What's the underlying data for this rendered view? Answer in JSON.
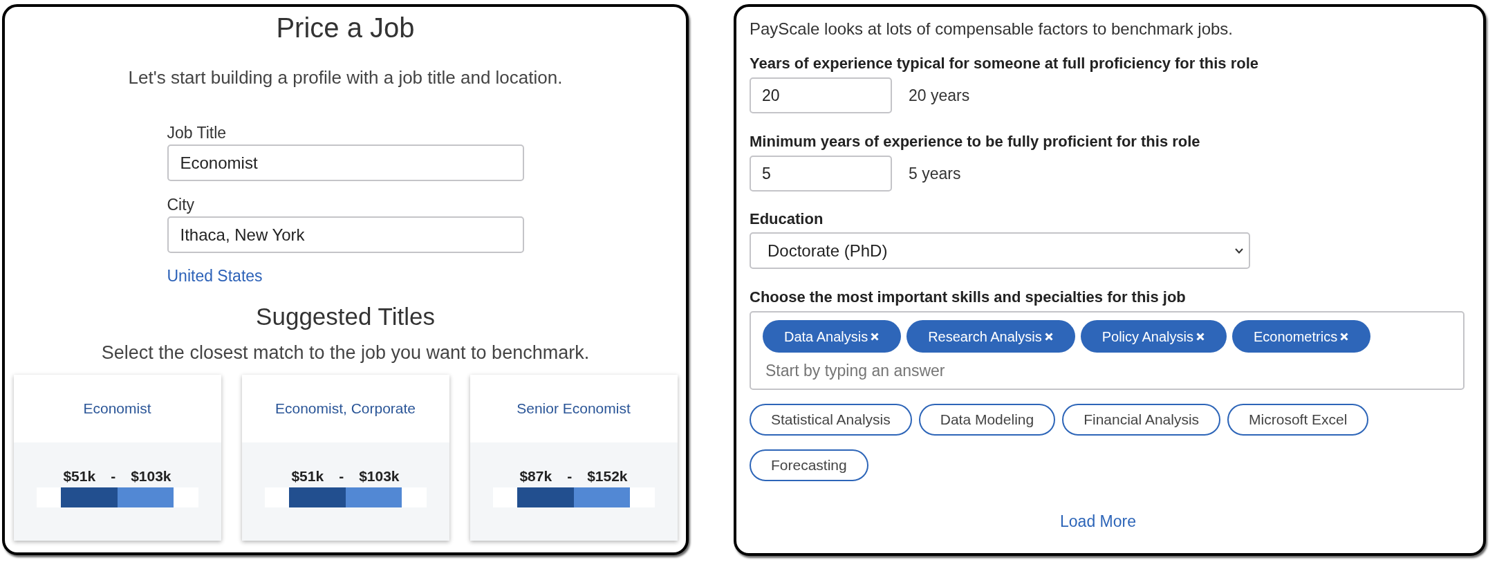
{
  "price_job_panel": {
    "title": "Price a Job",
    "subtitle": "Let's start building a profile with a job title and location.",
    "fields": [
      {
        "label": "Job Title",
        "value": "Economist"
      },
      {
        "label": "City",
        "value": "Ithaca, New York"
      }
    ],
    "country_link": "United States",
    "suggested_titles": {
      "heading": "Suggested Titles",
      "instruction": "Select the closest match to the job you want to benchmark.",
      "cards": [
        {
          "title": "Economist",
          "low": "$51k",
          "separator": "-",
          "high": "$103k"
        },
        {
          "title": "Economist, Corporate",
          "low": "$51k",
          "separator": "-",
          "high": "$103k"
        },
        {
          "title": "Senior Economist",
          "low": "$87k",
          "separator": "-",
          "high": "$152k"
        }
      ]
    }
  },
  "factors_panel": {
    "intro": "PayScale looks at lots of compensable factors to benchmark jobs.",
    "experience_fields": [
      {
        "label": "Years of experience typical for someone at full proficiency for this role",
        "value": "20",
        "reading": "20 years"
      },
      {
        "label": "Minimum years of experience to be fully proficient for this role",
        "value": "5",
        "reading": "5 years"
      }
    ],
    "education": {
      "label": "Education",
      "value": "Doctorate (PhD)"
    },
    "skills": {
      "label": "Choose the most important skills and specialties for this job",
      "selected_tags": [
        "Data Analysis",
        "Research Analysis",
        "Policy Analysis",
        "Econometrics"
      ],
      "placeholder": "Start by typing an answer",
      "suggestions": [
        "Statistical Analysis",
        "Data Modeling",
        "Financial Analysis",
        "Microsoft Excel",
        "Forecasting"
      ]
    },
    "load_more": "Load More"
  }
}
